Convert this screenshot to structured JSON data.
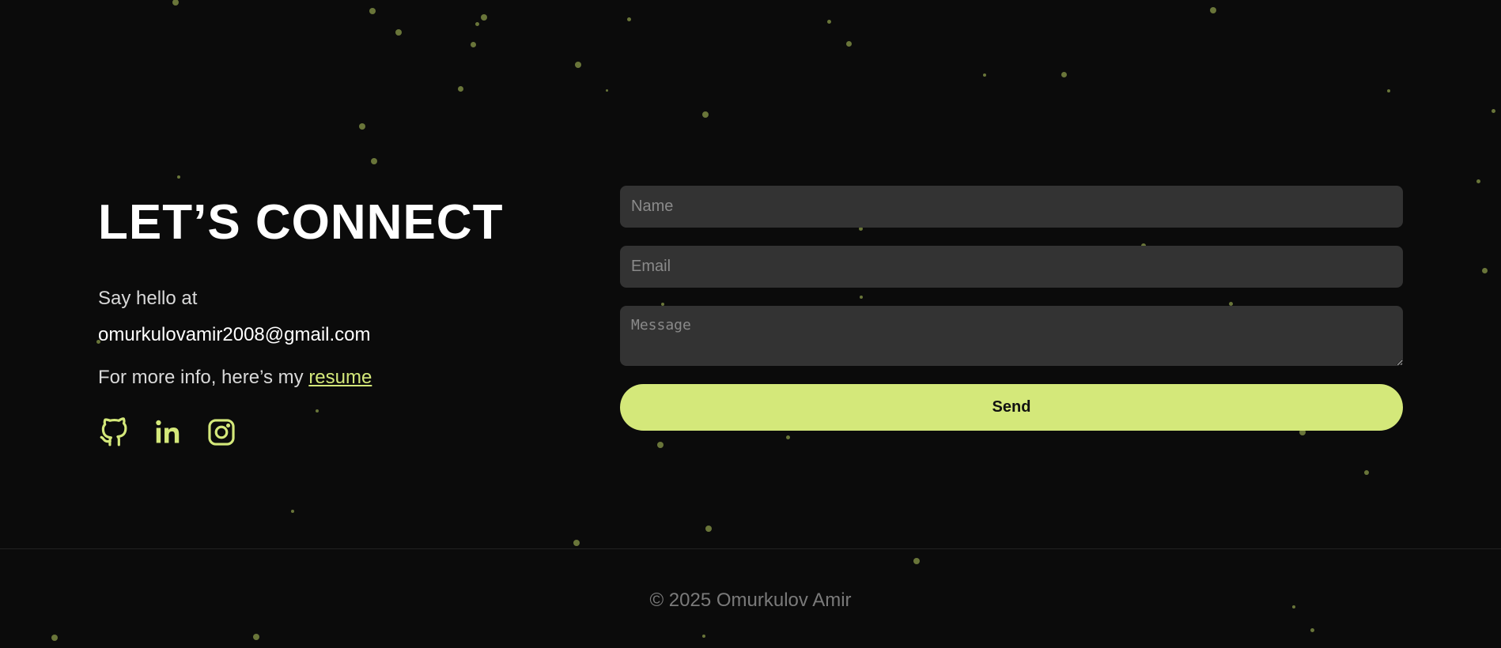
{
  "contact": {
    "heading": "LET’S CONNECT",
    "hello_text": "Say hello at",
    "email": "omurkulovamir2008@gmail.com",
    "more_info_prefix": "For more info, here’s my ",
    "resume_label": "resume",
    "socials": [
      {
        "icon": "github-icon"
      },
      {
        "icon": "linkedin-icon"
      },
      {
        "icon": "instagram-icon"
      }
    ]
  },
  "form": {
    "name_placeholder": "Name",
    "email_placeholder": "Email",
    "message_placeholder": "Message",
    "send_label": "Send"
  },
  "footer": {
    "copyright": "© 2025 Omurkulov Amir"
  },
  "colors": {
    "background": "#0b0b0b",
    "accent": "#d4e87a",
    "field_bg": "#333333"
  }
}
